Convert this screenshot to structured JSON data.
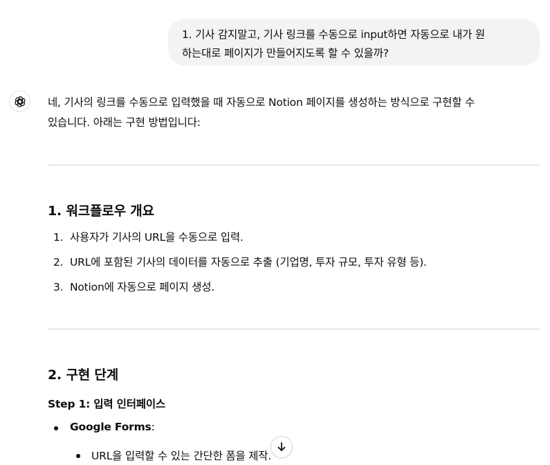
{
  "user_message": {
    "line1": "1. 기사 감지말고, 기사 링크를 수동으로 input하면 자동으로 내가 원",
    "line2": "하는대로 페이지가 만들어지도록 할 수 있을까?"
  },
  "assistant": {
    "avatar_icon": "openai-logo-icon",
    "intro_line1": "네, 기사의 링크를 수동으로 입력했을 때 자동으로 Notion 페이지를 생성하는 방식으로 구현할 수",
    "intro_line2": "있습니다. 아래는 구현 방법입니다:",
    "section1": {
      "heading": "1. 워크플로우 개요",
      "items": [
        {
          "num": "1.",
          "text": "사용자가 기사의 URL을 수동으로 입력."
        },
        {
          "num": "2.",
          "text": "URL에 포함된 기사의 데이터를 자동으로 추출 (기업명, 투자 규모, 투자 유형 등)."
        },
        {
          "num": "3.",
          "text": "Notion에 자동으로 페이지 생성."
        }
      ]
    },
    "section2": {
      "heading": "2. 구현 단계",
      "step1_label": "Step 1:",
      "step1_title": " 입력 인터페이스",
      "bullet1_bold": "Google Forms",
      "bullet1_rest": ":",
      "sub_bullet1": "URL을 입력할 수 있는 간단한 폼을 제작."
    }
  },
  "scroll_button": {
    "icon": "arrow-down-icon"
  }
}
